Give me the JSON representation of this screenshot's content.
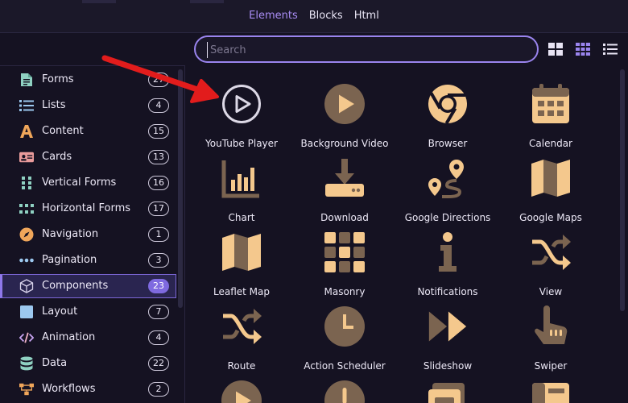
{
  "tabs": [
    {
      "label": "Elements",
      "active": true
    },
    {
      "label": "Blocks",
      "active": false
    },
    {
      "label": "Html",
      "active": false
    }
  ],
  "search": {
    "placeholder": "Search",
    "value": ""
  },
  "view_modes": [
    "grid-large-icon",
    "grid-small-icon",
    "list-icon"
  ],
  "sidebar": {
    "items": [
      {
        "label": "Forms",
        "count": "27",
        "icon": "form-document-icon"
      },
      {
        "label": "Lists",
        "count": "4",
        "icon": "list-icon"
      },
      {
        "label": "Content",
        "count": "15",
        "icon": "letter-a-icon"
      },
      {
        "label": "Cards",
        "count": "13",
        "icon": "id-card-icon"
      },
      {
        "label": "Vertical Forms",
        "count": "16",
        "icon": "vertical-form-icon"
      },
      {
        "label": "Horizontal Forms",
        "count": "17",
        "icon": "horizontal-form-icon"
      },
      {
        "label": "Navigation",
        "count": "1",
        "icon": "compass-icon"
      },
      {
        "label": "Pagination",
        "count": "3",
        "icon": "dots-icon"
      },
      {
        "label": "Components",
        "count": "23",
        "icon": "cube-icon",
        "active": true
      },
      {
        "label": "Layout",
        "count": "7",
        "icon": "layout-square-icon"
      },
      {
        "label": "Animation",
        "count": "4",
        "icon": "code-icon"
      },
      {
        "label": "Data",
        "count": "22",
        "icon": "database-icon"
      },
      {
        "label": "Workflows",
        "count": "2",
        "icon": "workflow-icon"
      }
    ]
  },
  "components": [
    {
      "label": "YouTube Player",
      "icon": "play-circle-outline-icon"
    },
    {
      "label": "Background Video",
      "icon": "play-circle-filled-icon"
    },
    {
      "label": "Browser",
      "icon": "chrome-icon"
    },
    {
      "label": "Calendar",
      "icon": "calendar-icon"
    },
    {
      "label": "Chart",
      "icon": "bar-chart-icon"
    },
    {
      "label": "Download",
      "icon": "download-icon"
    },
    {
      "label": "Google Directions",
      "icon": "route-pin-icon"
    },
    {
      "label": "Google Maps",
      "icon": "folded-map-icon"
    },
    {
      "label": "Leaflet Map",
      "icon": "folded-map-icon"
    },
    {
      "label": "Masonry",
      "icon": "masonry-grid-icon"
    },
    {
      "label": "Notifications",
      "icon": "info-icon"
    },
    {
      "label": "View",
      "icon": "shuffle-icon"
    },
    {
      "label": "Route",
      "icon": "shuffle-icon"
    },
    {
      "label": "Action Scheduler",
      "icon": "clock-icon"
    },
    {
      "label": "Slideshow",
      "icon": "fast-forward-icon"
    },
    {
      "label": "Swiper",
      "icon": "pointing-hand-icon"
    },
    {
      "label": "",
      "icon": "play-circle-filled-icon"
    },
    {
      "label": "",
      "icon": "alert-circle-icon"
    },
    {
      "label": "",
      "icon": "window-stack-icon"
    },
    {
      "label": "",
      "icon": "panel-icon"
    }
  ],
  "colors": {
    "accent": "#9a84ee",
    "icon_light": "#f4c88d",
    "icon_dark": "#7b6450",
    "background": "#151222"
  }
}
